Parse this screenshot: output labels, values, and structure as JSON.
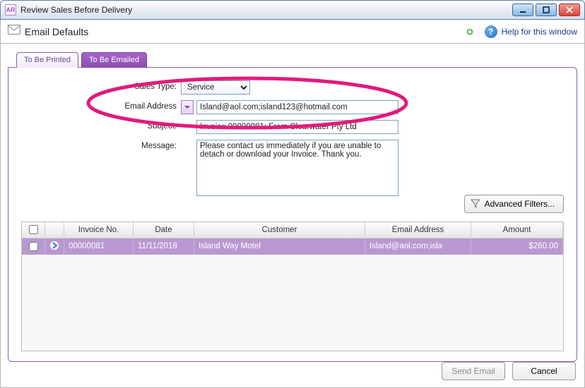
{
  "window": {
    "title": "Review Sales Before Delivery"
  },
  "header": {
    "section_title": "Email Defaults",
    "help_label": "Help for this window"
  },
  "tabs": {
    "printed": "To Be Printed",
    "emailed": "To Be Emailed"
  },
  "form": {
    "sales_type_label": "Sales Type:",
    "sales_type_value": "Service",
    "email_label": "Email Address",
    "email_value": "Island@aol.com;island123@hotmail.com",
    "subject_label": "Subject:",
    "subject_value": "Invoice 00000081; From Clearwater Pty Ltd",
    "message_label": "Message:",
    "message_value": "Please contact us immediately if you are unable to detach or download your Invoice. Thank you."
  },
  "advanced_filters_label": "Advanced Filters...",
  "table": {
    "headers": {
      "invoice": "Invoice No.",
      "date": "Date",
      "customer": "Customer",
      "email": "Email Address",
      "amount": "Amount"
    },
    "rows": [
      {
        "invoice": "00000081",
        "date": "11/11/2018",
        "customer": "Island Way Motel",
        "email": "Island@aol.com;isla",
        "amount": "$260.00"
      }
    ]
  },
  "footer": {
    "send": "Send Email",
    "cancel": "Cancel"
  }
}
